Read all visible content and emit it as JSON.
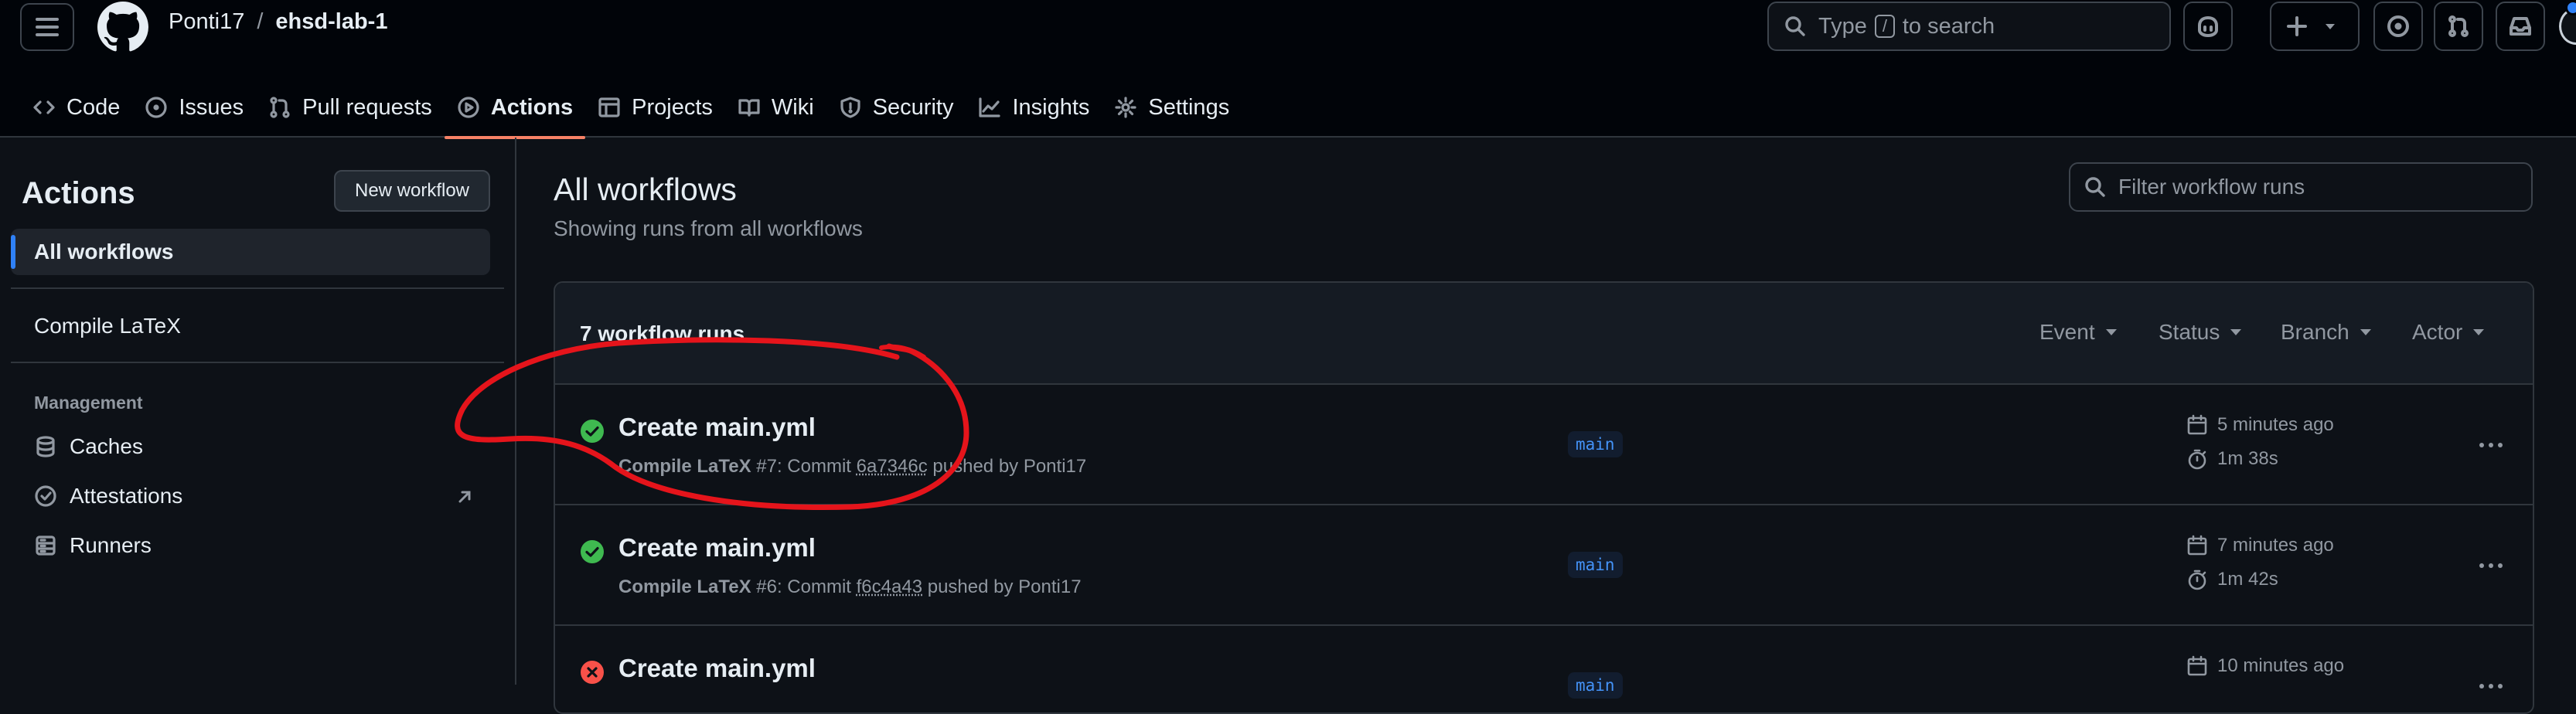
{
  "header": {
    "owner": "Ponti17",
    "separator": "/",
    "repo": "ehsd-lab-1",
    "search_prefix": "Type",
    "search_key": "/",
    "search_suffix": "to search"
  },
  "tabs": [
    {
      "label": "Code",
      "icon": "code-icon"
    },
    {
      "label": "Issues",
      "icon": "issue-icon"
    },
    {
      "label": "Pull requests",
      "icon": "pull-request-icon"
    },
    {
      "label": "Actions",
      "icon": "play-icon",
      "active": true
    },
    {
      "label": "Projects",
      "icon": "table-icon"
    },
    {
      "label": "Wiki",
      "icon": "book-icon"
    },
    {
      "label": "Security",
      "icon": "shield-icon"
    },
    {
      "label": "Insights",
      "icon": "graph-icon"
    },
    {
      "label": "Settings",
      "icon": "gear-icon"
    }
  ],
  "sidebar": {
    "title": "Actions",
    "new_workflow": "New workflow",
    "all_workflows": "All workflows",
    "workflows": [
      "Compile LaTeX"
    ],
    "management_label": "Management",
    "management": [
      "Caches",
      "Attestations",
      "Runners"
    ]
  },
  "main": {
    "title": "All workflows",
    "subtitle": "Showing runs from all workflows",
    "filter_placeholder": "Filter workflow runs",
    "runs_count": "7 workflow runs",
    "filters": [
      "Event",
      "Status",
      "Branch",
      "Actor"
    ],
    "runs": [
      {
        "title": "Create main.yml",
        "status": "success",
        "workflow": "Compile LaTeX",
        "run": "#7: Commit",
        "sha": "6a7346c",
        "pushed_by": "pushed by Ponti17",
        "branch": "main",
        "time": "5 minutes ago",
        "duration": "1m 38s"
      },
      {
        "title": "Create main.yml",
        "status": "success",
        "workflow": "Compile LaTeX",
        "run": "#6: Commit",
        "sha": "f6c4a43",
        "pushed_by": "pushed by Ponti17",
        "branch": "main",
        "time": "7 minutes ago",
        "duration": "1m 42s"
      },
      {
        "title": "Create main.yml",
        "status": "failure",
        "workflow": "",
        "run": "",
        "sha": "",
        "pushed_by": "",
        "branch": "main",
        "time": "10 minutes ago",
        "duration": ""
      }
    ]
  },
  "colors": {
    "background": "#0d1117",
    "header_bg": "#010409",
    "border": "#30363d",
    "accent_underline": "#f78166",
    "success": "#3fb950",
    "failure": "#f85149",
    "link_blue": "#4493f8",
    "annotation_red": "#e5141b"
  }
}
